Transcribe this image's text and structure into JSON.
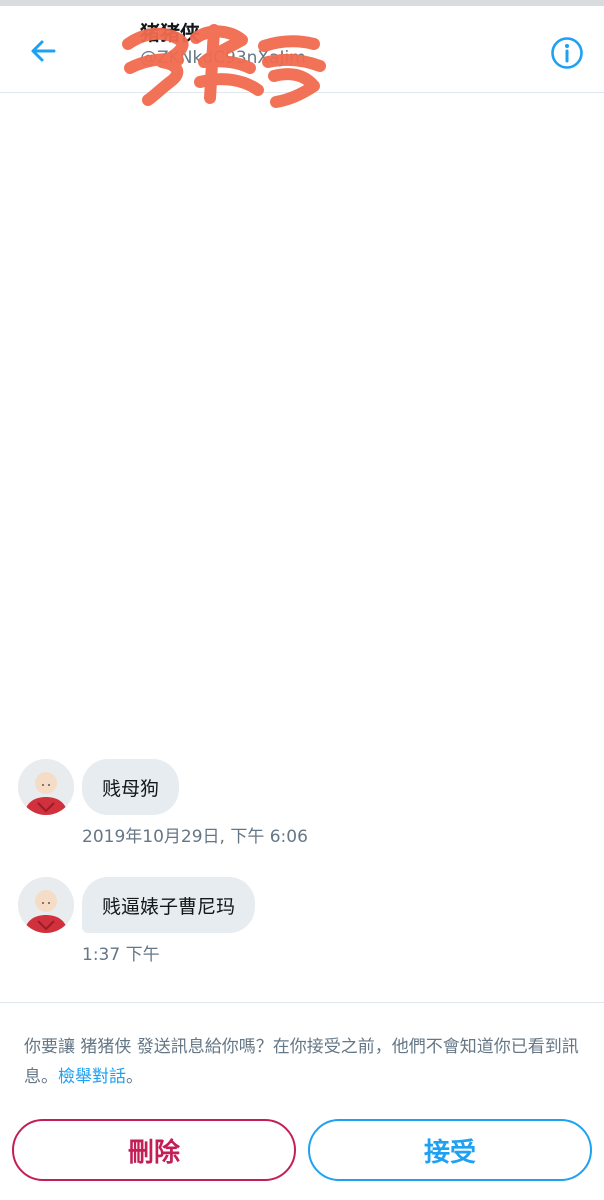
{
  "header": {
    "name": "猪猪侠",
    "handle": "@ZKNkdC93nXaJim",
    "back_icon": "arrow-left-icon",
    "info_icon": "info-circle-icon",
    "accent": "#1da1f2"
  },
  "messages": [
    {
      "text": "贱母狗",
      "time": "2019年10月29日, 下午 6:06"
    },
    {
      "text": "贱逼婊子曹尼玛",
      "time": "1:37 下午"
    }
  ],
  "request": {
    "prompt": "你要讓 猪猪侠 發送訊息給你嗎？在你接受之前，他們不會知道你已看到訊息。",
    "report_link": "檢舉對話",
    "report_suffix": "。",
    "delete_label": "刪除",
    "accept_label": "接受",
    "delete_color": "#c41e57",
    "accept_color": "#1da1f2"
  }
}
